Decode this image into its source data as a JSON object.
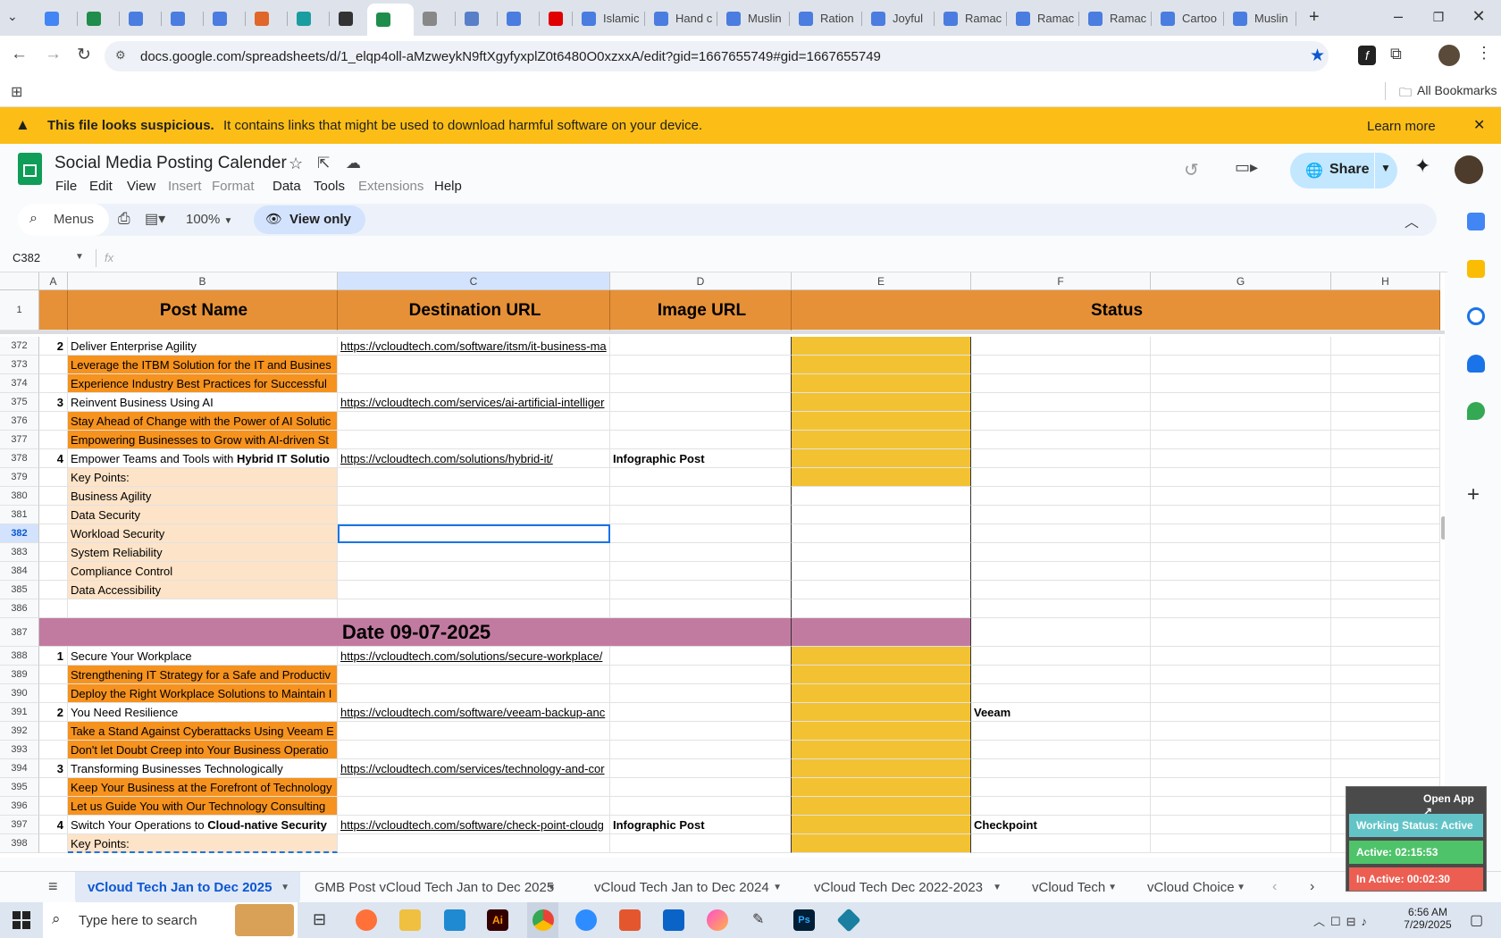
{
  "browser": {
    "tabs": [
      "",
      "",
      "",
      "",
      "",
      "",
      "",
      "",
      "",
      "",
      "",
      "",
      "",
      "Islamic",
      "Hand c",
      "Muslin",
      "Ration",
      "Joyful",
      "Ramac",
      "Ramac",
      "Ramac",
      "Cartoo",
      "Muslin"
    ],
    "url": "docs.google.com/spreadsheets/d/1_elqp4oll-aMzweykN9ftXgyfyxplZ0t6480O0xzxxA/edit?gid=1667655749#gid=1667655749",
    "bookmarks_label": "All Bookmarks"
  },
  "warning": {
    "bold": "This file looks suspicious.",
    "text": "It contains links that might be used to download harmful software on your device.",
    "learn_more": "Learn more"
  },
  "doc": {
    "title": "Social Media Posting Calender",
    "menus": [
      "File",
      "Edit",
      "View",
      "Insert",
      "Format",
      "Data",
      "Tools",
      "Extensions",
      "Help"
    ],
    "share": "Share"
  },
  "toolbar": {
    "menus": "Menus",
    "zoom": "100%",
    "view_only": "View only"
  },
  "formula": {
    "cell_ref": "C382",
    "fx": "fx"
  },
  "columns": [
    "A",
    "B",
    "C",
    "D",
    "E",
    "F",
    "G",
    "H"
  ],
  "header_row": {
    "num": "1",
    "b": "Post Name",
    "c": "Destination URL",
    "d": "Image URL",
    "status": "Status"
  },
  "rows": [
    {
      "n": "372",
      "a": "2",
      "b": "Deliver Enterprise Agility",
      "c": "https://vcloudtech.com/software/itsm/it-business-ma"
    },
    {
      "n": "373",
      "b": "Leverage the ITBM Solution for the IT and Busines"
    },
    {
      "n": "374",
      "b": "Experience Industry Best Practices for Successful"
    },
    {
      "n": "375",
      "a": "3",
      "b": "Reinvent Business Using AI",
      "c": "https://vcloudtech.com/services/ai-artificial-intelliger"
    },
    {
      "n": "376",
      "b": "Stay Ahead of Change with the Power of AI Solutic"
    },
    {
      "n": "377",
      "b": "Empowering Businesses to Grow with AI-driven St"
    },
    {
      "n": "378",
      "a": "4",
      "b": "Empower Teams and Tools with ",
      "bb": "Hybrid IT Solutio",
      "c": "https://vcloudtech.com/solutions/hybrid-it/",
      "d": "Infographic Post"
    },
    {
      "n": "379",
      "b": "Key Points:"
    },
    {
      "n": "380",
      "b": "Business Agility"
    },
    {
      "n": "381",
      "b": "Data Security"
    },
    {
      "n": "382",
      "b": "Workload Security"
    },
    {
      "n": "383",
      "b": "System Reliability"
    },
    {
      "n": "384",
      "b": "Compliance Control"
    },
    {
      "n": "385",
      "b": "Data Accessibility"
    },
    {
      "n": "386"
    },
    {
      "n": "387",
      "date": "Date 09-07-2025"
    },
    {
      "n": "388",
      "a": "1",
      "b": "Secure Your Workplace",
      "c": "https://vcloudtech.com/solutions/secure-workplace/"
    },
    {
      "n": "389",
      "b": "Strengthening IT Strategy for a Safe and Productiv"
    },
    {
      "n": "390",
      "b": "Deploy the Right Workplace Solutions to Maintain I"
    },
    {
      "n": "391",
      "a": "2",
      "b": "You Need Resilience",
      "c": "https://vcloudtech.com/software/veeam-backup-anc",
      "f": "Veeam"
    },
    {
      "n": "392",
      "b": "Take a Stand Against Cyberattacks Using Veeam E"
    },
    {
      "n": "393",
      "b": "Don't let Doubt Creep into Your Business Operatio"
    },
    {
      "n": "394",
      "a": "3",
      "b": "Transforming Businesses Technologically",
      "c": "https://vcloudtech.com/services/technology-and-cor"
    },
    {
      "n": "395",
      "b": "Keep Your Business at the Forefront of Technology"
    },
    {
      "n": "396",
      "b": "Let us Guide You with Our Technology Consulting"
    },
    {
      "n": "397",
      "a": "4",
      "b": "Switch Your Operations to ",
      "bb": "Cloud-native Security",
      "c": "https://vcloudtech.com/software/check-point-cloudg",
      "d": "Infographic Post",
      "f": "Checkpoint"
    },
    {
      "n": "398",
      "b": "Key Points:"
    }
  ],
  "sheet_tabs": [
    "vCloud Tech Jan to Dec 2025",
    "GMB Post vCloud Tech Jan to Dec 2025",
    "vCloud Tech Jan to Dec 2024",
    "vCloud Tech Dec 2022-2023",
    "vCloud Tech",
    "vCloud Choice"
  ],
  "taskbar": {
    "search": "Type here to search",
    "time": "6:56 AM",
    "date": "7/29/2025"
  },
  "widget": {
    "open_app": "Open App ↗",
    "working": "Working Status: Active",
    "active": "Active: 02:15:53",
    "inactive": "In Active: 00:02:30"
  }
}
